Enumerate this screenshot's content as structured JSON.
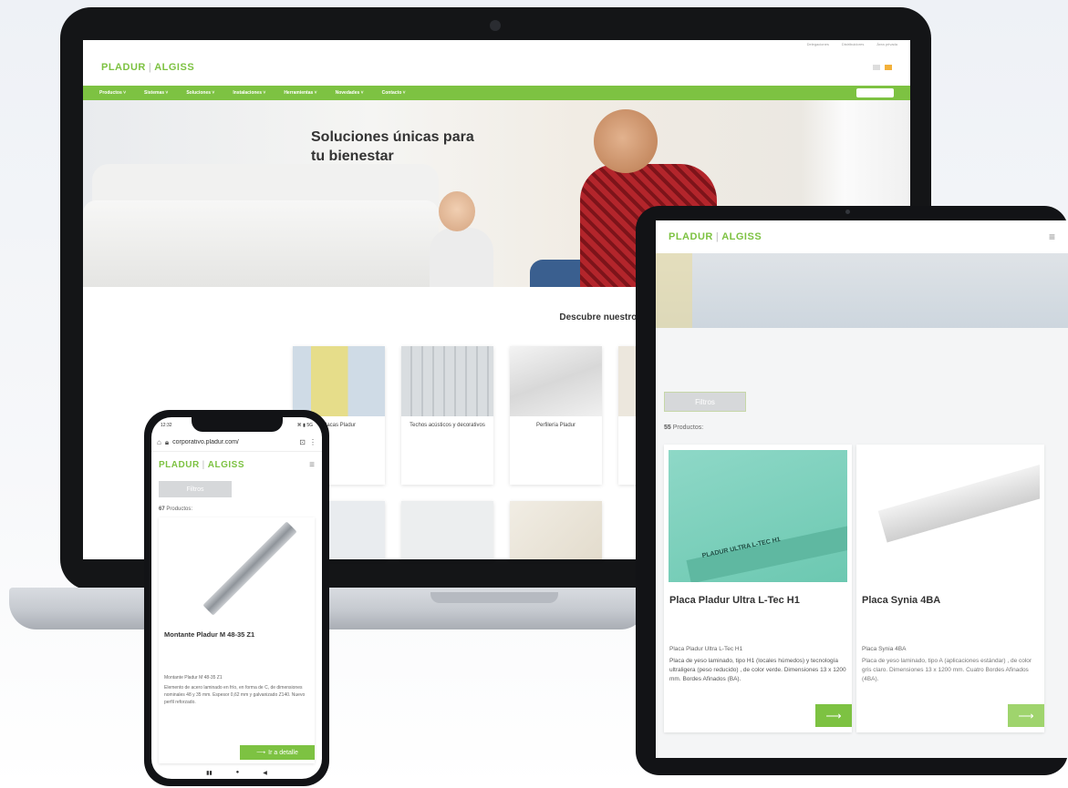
{
  "laptop": {
    "topbar": [
      "Delegaciones",
      "Distribuidores",
      "Área privada"
    ],
    "logo": {
      "left": "PLADUR",
      "sep": "|",
      "right": "ALGISS"
    },
    "nav": [
      "Productos ˅",
      "Sistemas ˅",
      "Soluciones ˅",
      "Instalaciones ˅",
      "Herramientas ˅",
      "Novedades ˅",
      "Contacto ˅"
    ],
    "search_label": "Buscar",
    "hero_title_line1": "Soluciones únicas para",
    "hero_title_line2": "tu bienestar",
    "products_title": "Descubre nuestros productos",
    "cards": [
      {
        "label": "Placas Pladur"
      },
      {
        "label": "Techos acústicos y decorativos"
      },
      {
        "label": "Perfilería Pladur"
      }
    ]
  },
  "tablet": {
    "logo": {
      "left": "PLADUR",
      "sep": "|",
      "right": "ALGISS"
    },
    "filter_label": "Filtros",
    "count_value": "55",
    "count_label": "Productos:",
    "products": [
      {
        "title": "Placa Pladur Ultra L-Tec H1",
        "subtitle": "Placa Pladur Ultra L-Tec H1",
        "description": "Placa de yeso laminado, tipo H1 (locales húmedos) y tecnología ultraligera (peso reducido) , de color verde. Dimensiones 13 x 1200 mm. Bordes Afinados (BA).",
        "image_text": "PLADUR   ULTRA L-TEC H1"
      },
      {
        "title": "Placa Synia 4BA",
        "subtitle": "Placa Synia 4BA",
        "description": "Placa de yeso laminado, tipo A (aplicaciones estándar) , de color gris claro. Dimensiones 13 x 1200 mm. Cuatro Bordes Afinados (4BA)."
      }
    ],
    "go_arrow": "⟶"
  },
  "phone": {
    "time": "12:32",
    "status_right": "⌘ ▮ 5G",
    "url": "corporativo.pladur.com/",
    "logo": {
      "left": "PLADUR",
      "sep": "|",
      "right": "ALGISS"
    },
    "filter_label": "Filtros",
    "count_value": "67",
    "count_label": "Productos:",
    "product": {
      "title": "Montante Pladur M 48-35 Z1",
      "subtitle": "Montante Pladur M 48-35 Z1",
      "description": "Elemento de acero laminado en frío, en forma de C, de dimensiones nominales 48 y 35 mm. Espesor 0,62 mm y galvanizado Z140. Nuevo perfil reforzado."
    },
    "go_label": "Ir a detalle",
    "go_arrow": "⟶"
  },
  "colors": {
    "brand_green": "#7dc242"
  }
}
